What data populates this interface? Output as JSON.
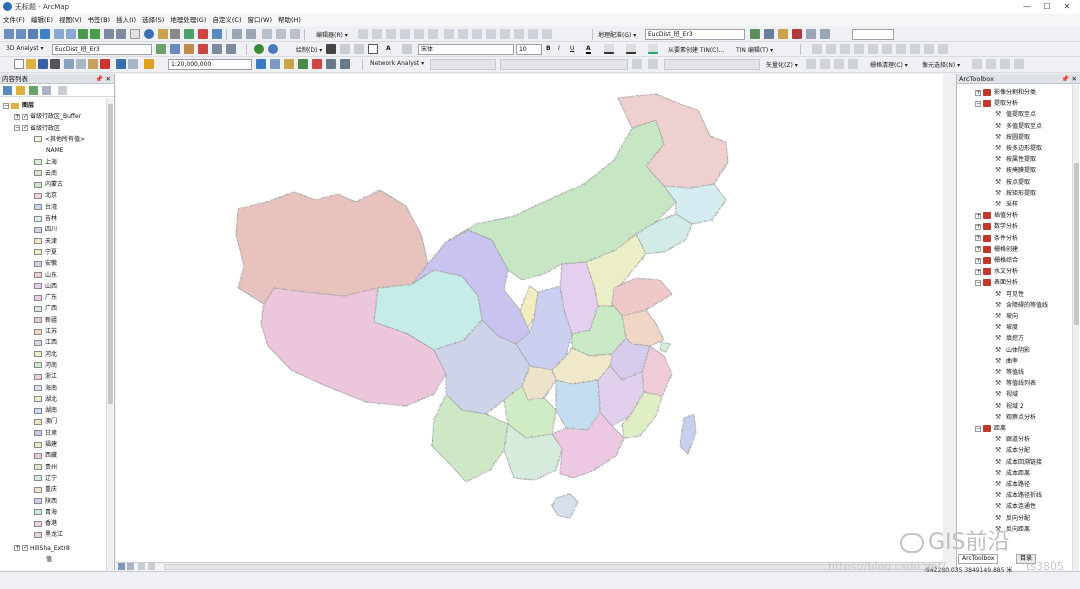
{
  "window": {
    "title": "无标题 - ArcMap",
    "controls": [
      "—",
      "☐",
      "✕"
    ]
  },
  "menu": [
    "文件(F)",
    "编辑(E)",
    "视图(V)",
    "书签(B)",
    "插入(I)",
    "选择(S)",
    "地理处理(G)",
    "自定义(C)",
    "窗口(W)",
    "帮助(H)"
  ],
  "toolbar": {
    "georef_label": "地理配准(G) ▾",
    "georef_layer": "EucDist_班_Er3",
    "editor_label": "编辑器(R) ▾",
    "analyst3d_label": "3D Analyst ▾",
    "analyst3d_layer": "EucDist_班_Er3",
    "draw_label": "绘制(D) ▾",
    "font_name": "宋体",
    "font_size": "10",
    "bold": "B",
    "italic": "I",
    "underline": "U",
    "tin_from_features": "从要素创建 TIN(C)...",
    "tin_editing": "TIN 编辑(T) ▾",
    "scale": "1:20,000,000",
    "network_analyst": "Network Analyst ▾",
    "vectorize": "矢量化(Z) ▾",
    "raster_clean": "栅格清理(C) ▾",
    "cell_select": "像元选择(N) ▾"
  },
  "toc": {
    "title": "内容列表",
    "root": "图层",
    "layers": [
      {
        "name": "省级行政区_Buffer",
        "checked": true
      },
      {
        "name": "省级行政区",
        "checked": true
      }
    ],
    "other_values": "<其他所有值>",
    "field": "NAME",
    "provinces": [
      {
        "name": "上海",
        "color": "#d7f0d7"
      },
      {
        "name": "云南",
        "color": "#cfe9c9"
      },
      {
        "name": "内蒙古",
        "color": "#c8e8c6"
      },
      {
        "name": "北京",
        "color": "#f0d6d6"
      },
      {
        "name": "台湾",
        "color": "#c9d3ef"
      },
      {
        "name": "吉林",
        "color": "#d5edf0"
      },
      {
        "name": "四川",
        "color": "#cdd4e8"
      },
      {
        "name": "天津",
        "color": "#f2e7c6"
      },
      {
        "name": "宁夏",
        "color": "#f2efc3"
      },
      {
        "name": "安徽",
        "color": "#d9cdee"
      },
      {
        "name": "山东",
        "color": "#f0cccc"
      },
      {
        "name": "山西",
        "color": "#e7d1ee"
      },
      {
        "name": "广东",
        "color": "#eecbe6"
      },
      {
        "name": "广西",
        "color": "#d6ecdf"
      },
      {
        "name": "新疆",
        "color": "#eccbc4"
      },
      {
        "name": "江苏",
        "color": "#f0d8c7"
      },
      {
        "name": "江西",
        "color": "#e3d2ec"
      },
      {
        "name": "河北",
        "color": "#ecefc8"
      },
      {
        "name": "河南",
        "color": "#ccecc9"
      },
      {
        "name": "浙江",
        "color": "#efcdd9"
      },
      {
        "name": "海南",
        "color": "#d8e2ef"
      },
      {
        "name": "湖北",
        "color": "#f1ebcc"
      },
      {
        "name": "湖南",
        "color": "#c7dff0"
      },
      {
        "name": "澳门",
        "color": "#f3e3c7"
      },
      {
        "name": "甘肃",
        "color": "#c9c5ee"
      },
      {
        "name": "福建",
        "color": "#e2efc9"
      },
      {
        "name": "西藏",
        "color": "#efc8d9"
      },
      {
        "name": "贵州",
        "color": "#d2edc7"
      },
      {
        "name": "辽宁",
        "color": "#d3ecea"
      },
      {
        "name": "重庆",
        "color": "#f0e4ce"
      },
      {
        "name": "陕西",
        "color": "#ccd0ef"
      },
      {
        "name": "青海",
        "color": "#c8ece9"
      },
      {
        "name": "香港",
        "color": "#ecd0ec"
      },
      {
        "name": "黑龙江",
        "color": "#f0d3d3"
      }
    ],
    "hillshade_layer": "HillSha_Extr8",
    "hillshade_value": "值"
  },
  "toolbox": {
    "title": "ArcToolbox",
    "items": [
      {
        "label": "影像分割和分类",
        "level": 1,
        "type": "box",
        "exp": "+"
      },
      {
        "label": "提取分析",
        "level": 1,
        "type": "box",
        "exp": "−"
      },
      {
        "label": "值提取至点",
        "level": 2,
        "type": "tool"
      },
      {
        "label": "多值提取至点",
        "level": 2,
        "type": "tool"
      },
      {
        "label": "按圆提取",
        "level": 2,
        "type": "tool"
      },
      {
        "label": "按多边形提取",
        "level": 2,
        "type": "tool"
      },
      {
        "label": "按属性提取",
        "level": 2,
        "type": "tool"
      },
      {
        "label": "按掩膜提取",
        "level": 2,
        "type": "tool"
      },
      {
        "label": "按点提取",
        "level": 2,
        "type": "tool"
      },
      {
        "label": "按矩形提取",
        "level": 2,
        "type": "tool"
      },
      {
        "label": "采样",
        "level": 2,
        "type": "tool"
      },
      {
        "label": "插值分析",
        "level": 1,
        "type": "box",
        "exp": "+"
      },
      {
        "label": "数学分析",
        "level": 1,
        "type": "box",
        "exp": "+"
      },
      {
        "label": "条件分析",
        "level": 1,
        "type": "box",
        "exp": "+"
      },
      {
        "label": "栅格创建",
        "level": 1,
        "type": "box",
        "exp": "+"
      },
      {
        "label": "栅格综合",
        "level": 1,
        "type": "box",
        "exp": "+"
      },
      {
        "label": "水文分析",
        "level": 1,
        "type": "box",
        "exp": "+"
      },
      {
        "label": "表面分析",
        "level": 1,
        "type": "box",
        "exp": "−"
      },
      {
        "label": "可见性",
        "level": 2,
        "type": "tool"
      },
      {
        "label": "含障碍的等值线",
        "level": 2,
        "type": "tool"
      },
      {
        "label": "坡向",
        "level": 2,
        "type": "tool"
      },
      {
        "label": "坡度",
        "level": 2,
        "type": "tool"
      },
      {
        "label": "填挖方",
        "level": 2,
        "type": "tool"
      },
      {
        "label": "山体阴影",
        "level": 2,
        "type": "tool"
      },
      {
        "label": "曲率",
        "level": 2,
        "type": "tool"
      },
      {
        "label": "等值线",
        "level": 2,
        "type": "tool"
      },
      {
        "label": "等值线列表",
        "level": 2,
        "type": "tool"
      },
      {
        "label": "视域",
        "level": 2,
        "type": "tool"
      },
      {
        "label": "视域 2",
        "level": 2,
        "type": "tool"
      },
      {
        "label": "观察点分析",
        "level": 2,
        "type": "tool"
      },
      {
        "label": "距离",
        "level": 1,
        "type": "box",
        "exp": "−"
      },
      {
        "label": "廊道分析",
        "level": 2,
        "type": "tool"
      },
      {
        "label": "成本分配",
        "level": 2,
        "type": "tool"
      },
      {
        "label": "成本回溯链接",
        "level": 2,
        "type": "tool"
      },
      {
        "label": "成本距离",
        "level": 2,
        "type": "tool"
      },
      {
        "label": "成本路径",
        "level": 2,
        "type": "tool"
      },
      {
        "label": "成本路径折线",
        "level": 2,
        "type": "tool"
      },
      {
        "label": "成本连通性",
        "level": 2,
        "type": "tool"
      },
      {
        "label": "反向分配",
        "level": 2,
        "type": "tool"
      },
      {
        "label": "反向距离",
        "level": 2,
        "type": "tool"
      }
    ]
  },
  "status": {
    "coordinates": "-942280.035  3849149.885 米"
  },
  "tabs": [
    "ArcToolbox",
    "目录"
  ],
  "watermarks": {
    "brand": "GIS前沿",
    "url": "https://blog.csdn.net/...",
    "code": "ts3805"
  },
  "map_colors": {
    "xinjiang": "#e8c3bd",
    "tibet": "#ecc6da",
    "qinghai": "#c6ece8",
    "gansu": "#c8c3ef",
    "neimenggu": "#c7e7c4",
    "heilongjiang": "#efd0d0",
    "jilin": "#d3edf0",
    "liaoning": "#d1ebe7",
    "sichuan": "#cdd3e9",
    "yunnan": "#cee8c6",
    "guangxi": "#d5ecdd",
    "guangdong": "#ecc8e3",
    "hunan": "#c5ddf0",
    "hubei": "#f0e9c9",
    "henan": "#c9eac5",
    "shandong": "#efc9c9",
    "hebei": "#ebeec6",
    "shanxi": "#e5cfee",
    "shaanxi": "#cacfef",
    "ningxia": "#f1edbf",
    "guizhou": "#d0ecc4",
    "chongqing": "#efe2cb",
    "anhui": "#d7cbee",
    "jiangsu": "#efd6c5",
    "zhejiang": "#eecbd7",
    "fujian": "#e0eec6",
    "jiangxi": "#e1d0eb",
    "taiwan": "#c7d1ee",
    "hainan": "#d5dfee",
    "beijing": "#efd3d3",
    "tianjin": "#f1e5c4",
    "shanghai": "#d5efd5"
  }
}
